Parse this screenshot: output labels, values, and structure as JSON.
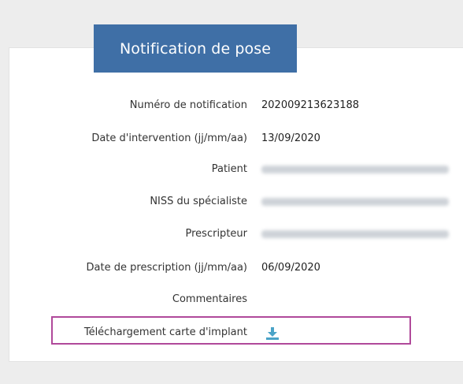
{
  "header": {
    "title": "Notification de pose"
  },
  "fields": [
    {
      "label": "Numéro de notification",
      "value": "202009213623188"
    },
    {
      "label": "Date d'intervention (jj/mm/aa)",
      "value": "13/09/2020"
    },
    {
      "label": "Patient",
      "value": ""
    },
    {
      "label": "NISS du spécialiste",
      "value": ""
    },
    {
      "label": "Prescripteur",
      "value": ""
    },
    {
      "label": "Date de prescription (jj/mm/aa)",
      "value": "06/09/2020"
    },
    {
      "label": "Commentaires",
      "value": ""
    }
  ],
  "download": {
    "label": "Téléchargement carte d'implant",
    "icon": "download-icon"
  },
  "colors": {
    "title_bg": "#3f6fa6",
    "highlight_border": "#b0499a",
    "icon": "#4aa3c7"
  }
}
